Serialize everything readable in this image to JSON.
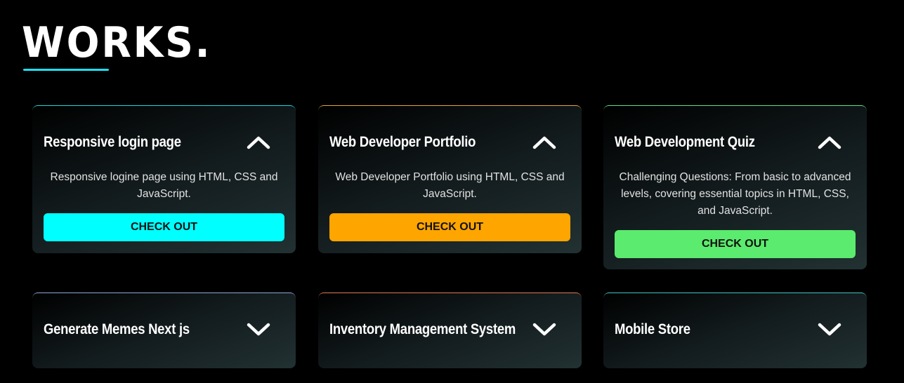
{
  "section": {
    "title": "WORKS.",
    "underline_color": "#19e0ef"
  },
  "cards": [
    {
      "title": "Responsive login page",
      "description": "Responsive logine page using HTML, CSS and JavaScript.",
      "button_label": "CHECK OUT",
      "accent": "#1ad7dd",
      "button_color": "#00ffff",
      "expanded": true,
      "toggle_icon": "chevron-up-icon"
    },
    {
      "title": "Web Developer Portfolio",
      "description": "Web Developer Portfolio using HTML, CSS and JavaScript.",
      "button_label": "CHECK OUT",
      "accent": "#e8a23c",
      "button_color": "#ffa500",
      "expanded": true,
      "toggle_icon": "chevron-up-icon"
    },
    {
      "title": "Web Development Quiz",
      "description": "Challenging Questions: From basic to advanced levels, covering essential topics in HTML, CSS, and JavaScript.",
      "button_label": "CHECK OUT",
      "accent": "#5fe07e",
      "button_color": "#5beb6e",
      "expanded": true,
      "toggle_icon": "chevron-up-icon"
    },
    {
      "title": "Generate Memes Next js",
      "expanded": false,
      "accent": "#8fa9d8",
      "toggle_icon": "chevron-down-icon"
    },
    {
      "title": "Inventory Management System",
      "expanded": false,
      "accent": "#e07a52",
      "toggle_icon": "chevron-down-icon"
    },
    {
      "title": "Mobile Store",
      "expanded": false,
      "accent": "#3fc7c2",
      "toggle_icon": "chevron-down-icon"
    }
  ]
}
